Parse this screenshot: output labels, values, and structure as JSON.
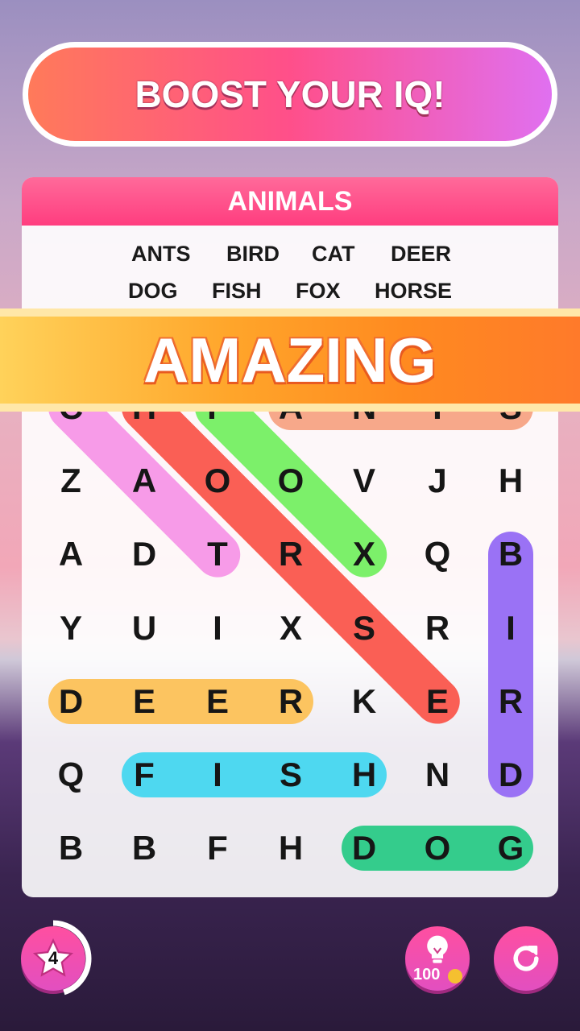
{
  "header": {
    "boost_label": "BOOST YOUR IQ!"
  },
  "puzzle": {
    "category": "ANIMALS",
    "words": [
      "ANTS",
      "BIRD",
      "CAT",
      "DEER",
      "DOG",
      "FISH",
      "FOX",
      "HORSE"
    ],
    "grid": [
      [
        "C",
        "H",
        "F",
        "A",
        "N",
        "T",
        "S"
      ],
      [
        "Z",
        "A",
        "O",
        "O",
        "V",
        "J",
        "H"
      ],
      [
        "A",
        "D",
        "T",
        "R",
        "X",
        "Q",
        "B"
      ],
      [
        "Y",
        "U",
        "I",
        "X",
        "S",
        "R",
        "I"
      ],
      [
        "D",
        "E",
        "E",
        "R",
        "K",
        "E",
        "R"
      ],
      [
        "Q",
        "F",
        "I",
        "S",
        "H",
        "N",
        "D"
      ],
      [
        "B",
        "B",
        "F",
        "H",
        "D",
        "O",
        "G"
      ]
    ],
    "found": [
      {
        "word": "CAT",
        "color": "#f79be8",
        "from": [
          0,
          0
        ],
        "to": [
          2,
          2
        ]
      },
      {
        "word": "HORSE",
        "color": "#fa5f55",
        "from": [
          0,
          1
        ],
        "to": [
          4,
          5
        ]
      },
      {
        "word": "FOX",
        "color": "#7cf06a",
        "from": [
          0,
          2
        ],
        "to": [
          2,
          4
        ]
      },
      {
        "word": "ANTS",
        "color": "#f7a88a",
        "from": [
          0,
          3
        ],
        "to": [
          0,
          6
        ]
      },
      {
        "word": "BIRD",
        "color": "#9a72f5",
        "from": [
          2,
          6
        ],
        "to": [
          5,
          6
        ]
      },
      {
        "word": "DEER",
        "color": "#fcc460",
        "from": [
          4,
          0
        ],
        "to": [
          4,
          3
        ]
      },
      {
        "word": "FISH",
        "color": "#4ed8f0",
        "from": [
          5,
          1
        ],
        "to": [
          5,
          4
        ]
      },
      {
        "word": "DOG",
        "color": "#34cc8c",
        "from": [
          6,
          4
        ],
        "to": [
          6,
          6
        ]
      }
    ]
  },
  "feedback": {
    "text": "AMAZING"
  },
  "footer": {
    "level": "4",
    "level_progress": 0.45,
    "hint_cost": "100",
    "icons": [
      "star-icon",
      "lightbulb-icon",
      "coin-icon",
      "restart-icon"
    ]
  }
}
